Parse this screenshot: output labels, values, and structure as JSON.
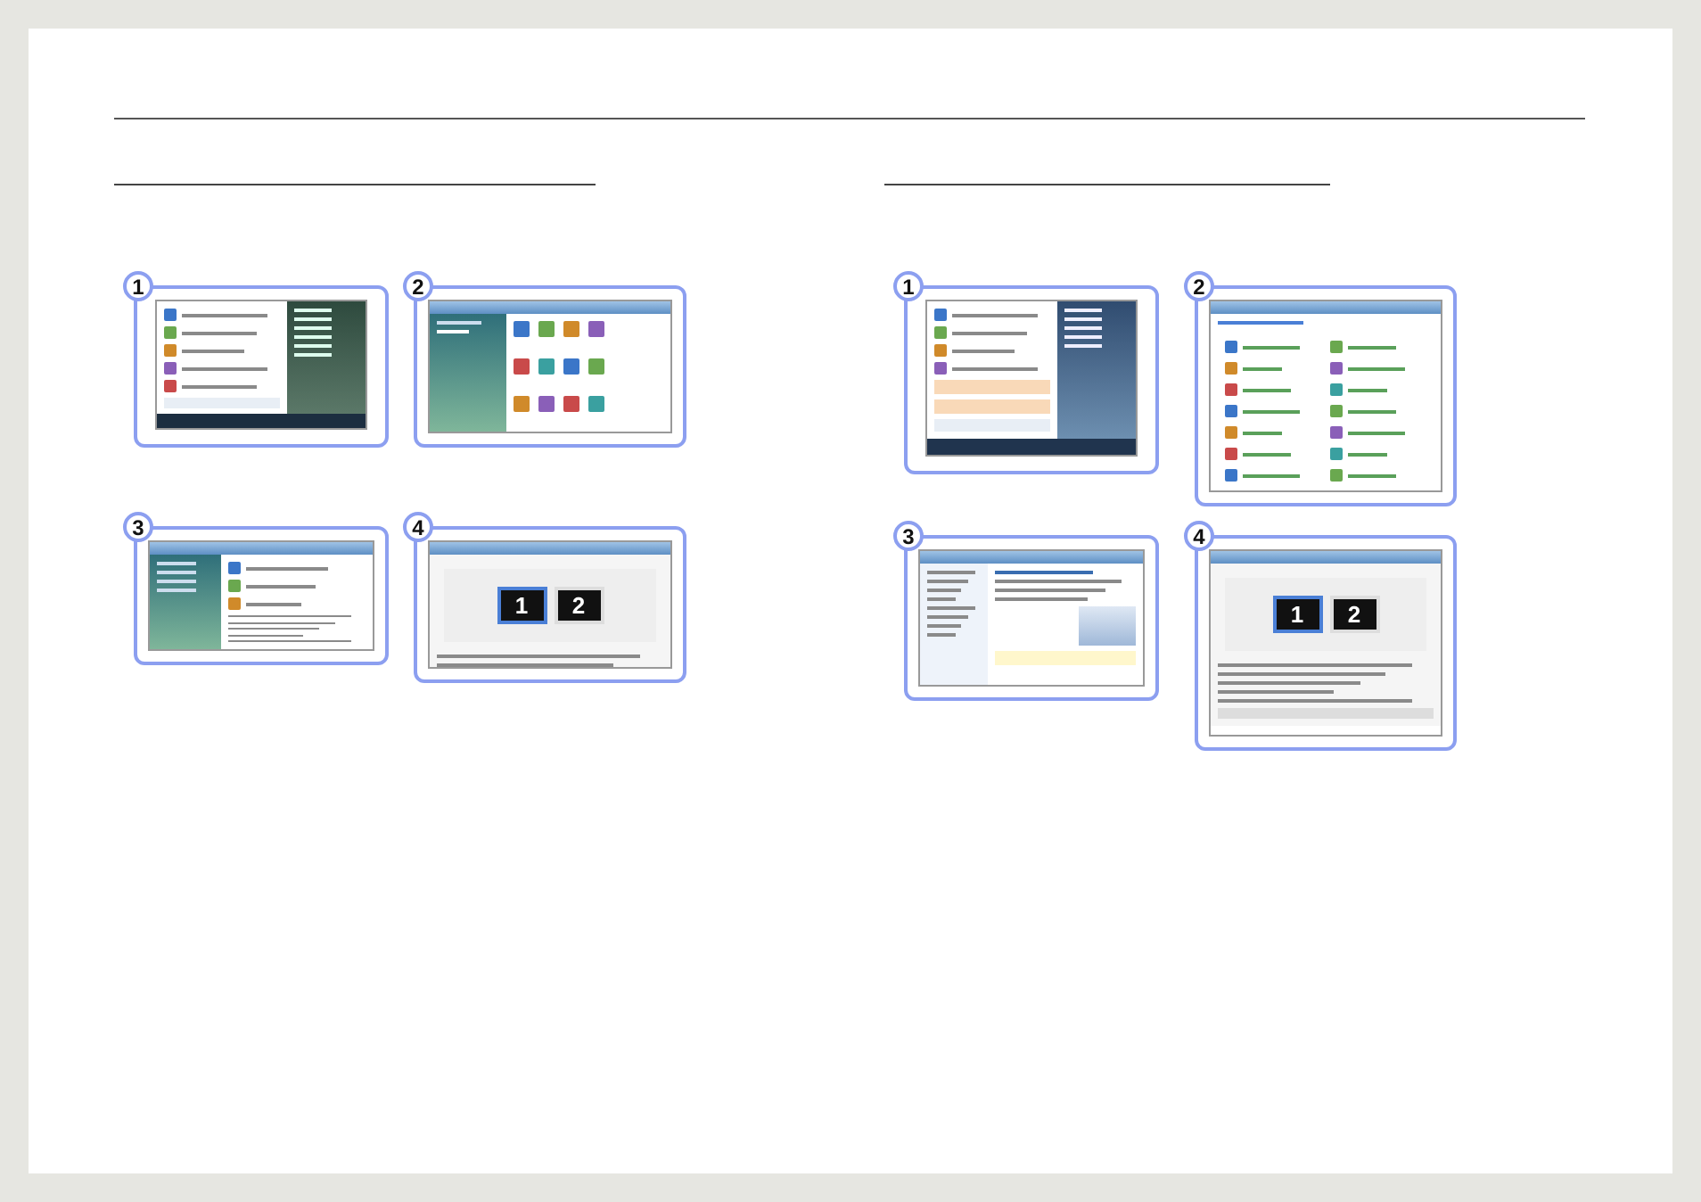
{
  "sections": [
    {
      "steps": [
        {
          "number": "1",
          "kind": "start-menu"
        },
        {
          "number": "2",
          "kind": "control-panel"
        },
        {
          "number": "3",
          "kind": "personalization"
        },
        {
          "number": "4",
          "kind": "display-settings",
          "monitors": [
            "1",
            "2"
          ]
        }
      ]
    },
    {
      "steps": [
        {
          "number": "1",
          "kind": "start-menu-7"
        },
        {
          "number": "2",
          "kind": "control-panel-7"
        },
        {
          "number": "3",
          "kind": "display-7"
        },
        {
          "number": "4",
          "kind": "resolution-7",
          "monitors": [
            "1",
            "2"
          ]
        }
      ]
    }
  ]
}
